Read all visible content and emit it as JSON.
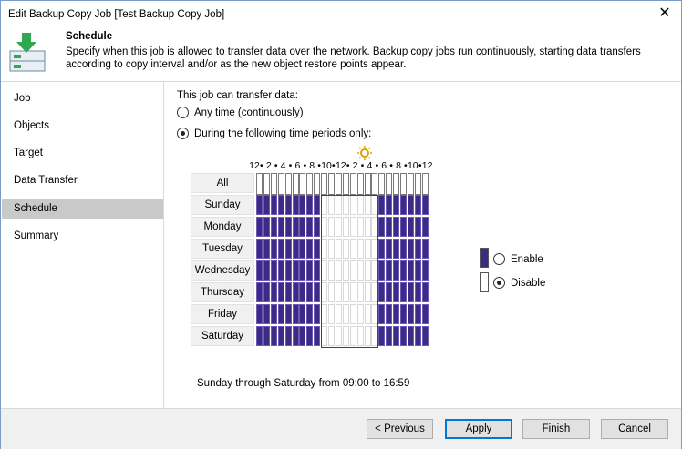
{
  "window": {
    "title": "Edit Backup Copy Job [Test Backup Copy Job]",
    "close_glyph": "✕"
  },
  "header": {
    "title": "Schedule",
    "description": "Specify when this job is allowed to transfer data over the network. Backup copy jobs run continuously, starting data transfers according to copy interval and/or as the new object restore points appear.",
    "icon": "schedule-download-icon"
  },
  "sidebar": {
    "items": [
      {
        "label": "Job",
        "active": false
      },
      {
        "label": "Objects",
        "active": false
      },
      {
        "label": "Target",
        "active": false
      },
      {
        "label": "Data Transfer",
        "active": false
      },
      {
        "label": "Schedule",
        "active": true
      },
      {
        "label": "Summary",
        "active": false
      }
    ]
  },
  "schedule": {
    "intro": "This job can transfer data:",
    "options": [
      {
        "label": "Any time (continuously)",
        "checked": false
      },
      {
        "label": "During the following time periods only:",
        "checked": true
      }
    ],
    "hour_labels": [
      "12",
      "•",
      "2",
      "•",
      "4",
      "•",
      "6",
      "•",
      "8",
      "•",
      "10",
      "•",
      "12",
      "•",
      "2",
      "•",
      "4",
      "•",
      "6",
      "•",
      "8",
      "•",
      "10",
      "•",
      "12"
    ],
    "all_label": "All",
    "days": [
      "Sunday",
      "Monday",
      "Tuesday",
      "Wednesday",
      "Thursday",
      "Friday",
      "Saturday"
    ],
    "enabled_hours_start": 9,
    "enabled_hours_end": 17,
    "legend": [
      {
        "label": "Enable",
        "checked": false,
        "color": "#3d2a84"
      },
      {
        "label": "Disable",
        "checked": true,
        "color": "#ffffff"
      }
    ],
    "summary": "Sunday through Saturday from 09:00 to 16:59",
    "icons": [
      "moon-icon",
      "sun-icon",
      "moon-icon"
    ]
  },
  "footer": {
    "previous": "< Previous",
    "apply": "Apply",
    "finish": "Finish",
    "cancel": "Cancel"
  }
}
